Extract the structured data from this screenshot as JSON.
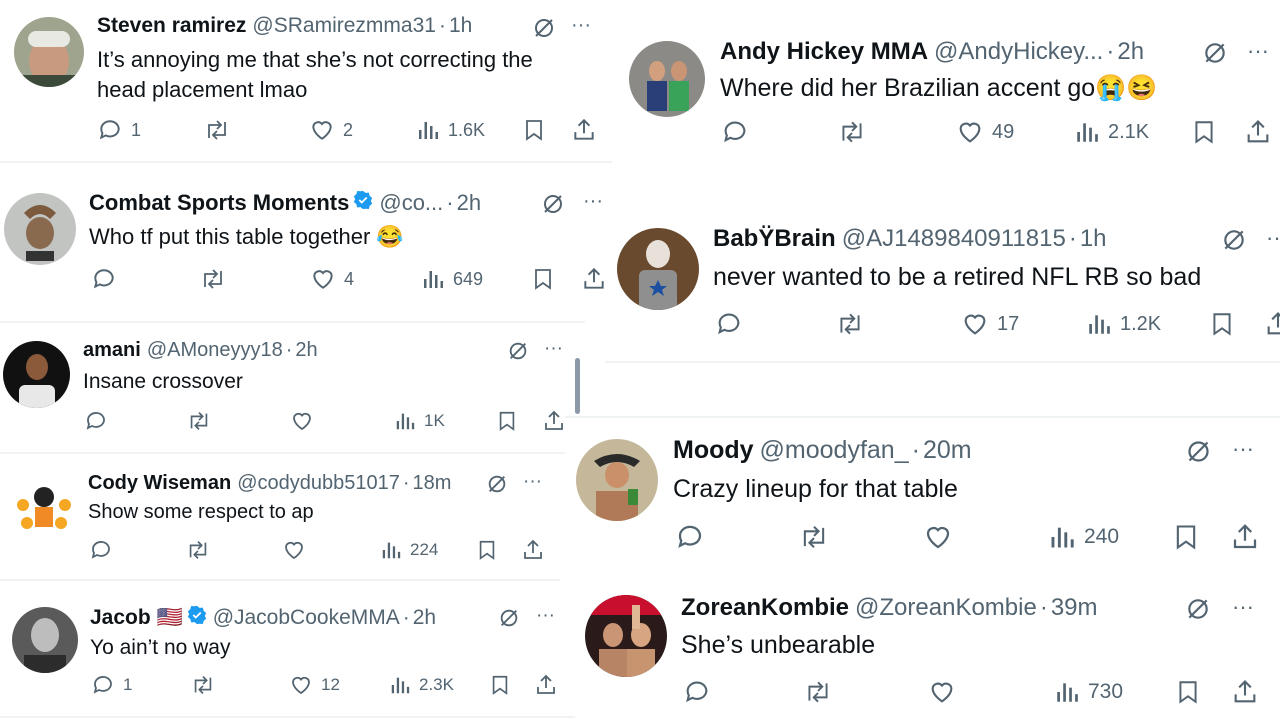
{
  "left": [
    {
      "name": "Steven ramirez",
      "handle": "@SRamirezmma31",
      "time": "1h",
      "text": [
        "It’s annoying me that she’s not correcting the",
        "head placement lmao"
      ],
      "replies": "1",
      "likes": "2",
      "views": "1.6K"
    },
    {
      "name": "Combat Sports Moments",
      "handle": "@co...",
      "time": "2h",
      "text": [
        "Who tf put this table together 😂"
      ],
      "replies": "",
      "likes": "4",
      "views": "649"
    },
    {
      "name": "amani",
      "handle": "@AMoneyyy18",
      "time": "2h",
      "text": [
        "Insane crossover"
      ],
      "replies": "",
      "likes": "",
      "views": "1K"
    },
    {
      "name": "Cody Wiseman",
      "handle": "@codydubb51017",
      "time": "18m",
      "text": [
        "Show some respect to ap"
      ],
      "replies": "",
      "likes": "",
      "views": "224"
    },
    {
      "name": "Jacob 🇺🇸",
      "handle": "@JacobCookeMMA",
      "time": "2h",
      "text": [
        "Yo ain’t no way"
      ],
      "replies": "1",
      "likes": "12",
      "views": "2.3K"
    }
  ],
  "right": [
    {
      "name": "Andy Hickey MMA",
      "handle": "@AndyHickey...",
      "time": "2h",
      "text": [
        "Where did her Brazilian accent go😭😆"
      ],
      "replies": "",
      "likes": "49",
      "views": "2.1K"
    },
    {
      "name": "BabŸBrain",
      "handle": "@AJ1489840911815",
      "time": "1h",
      "text": [
        "never wanted to be a retired NFL RB so bad"
      ],
      "replies": "",
      "likes": "17",
      "views": "1.2K"
    },
    {
      "name": "Moody",
      "handle": "@moodyfan_",
      "time": "20m",
      "text": [
        "Crazy lineup for that table"
      ],
      "replies": "",
      "likes": "",
      "views": "240"
    },
    {
      "name": "ZoreanKombie",
      "handle": "@ZoreanKombie",
      "time": "39m",
      "text": [
        "She’s unbearable"
      ],
      "replies": "",
      "likes": "",
      "views": "730"
    }
  ],
  "ui": {
    "dot": "·",
    "more": "···"
  },
  "colors": {
    "verified": "#1d9bf0",
    "text": "#0f1419",
    "muted": "#536471",
    "separator": "#eff3f4"
  }
}
